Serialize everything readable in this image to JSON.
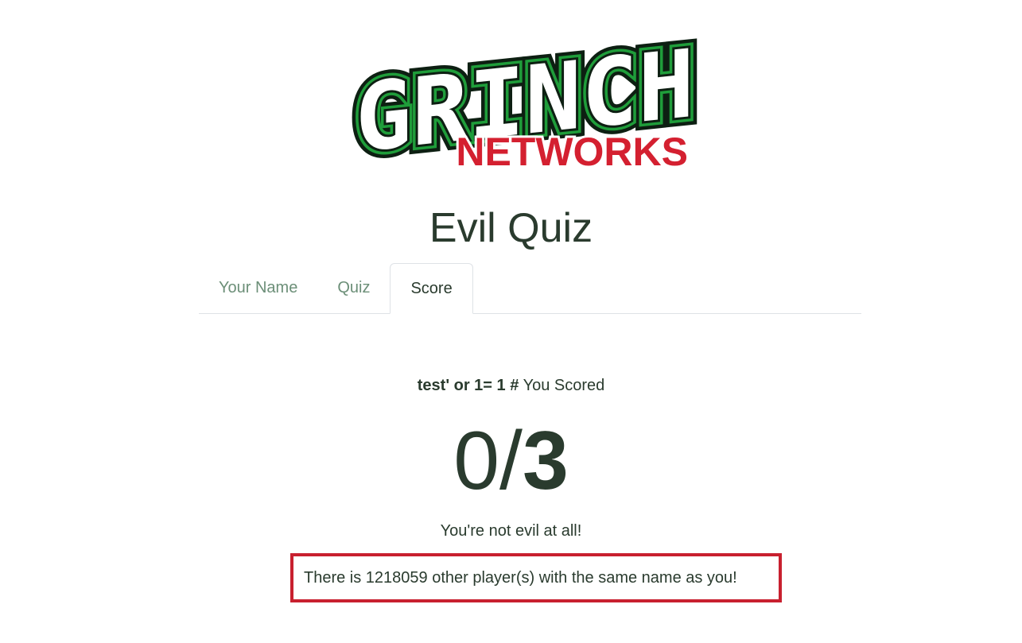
{
  "logo": {
    "top_text": "GRINCH",
    "bottom_text": "NETWORKS",
    "colors": {
      "green": "#1f9d3a",
      "dark": "#0d1f12",
      "red": "#d42030"
    }
  },
  "title": "Evil Quiz",
  "tabs": [
    {
      "label": "Your Name",
      "active": false
    },
    {
      "label": "Quiz",
      "active": false
    },
    {
      "label": "Score",
      "active": true
    }
  ],
  "result": {
    "player_name": "test' or 1= 1 #",
    "scored_label": "You Scored",
    "score": "0",
    "separator": "/",
    "total": "3",
    "verdict": "You're not evil at all!",
    "duplicate_notice": "There is 1218059 other player(s) with the same name as you!"
  },
  "colors": {
    "text": "#2a3b2e",
    "tab_inactive": "#6c8f78",
    "highlight_border": "#c8202f"
  }
}
